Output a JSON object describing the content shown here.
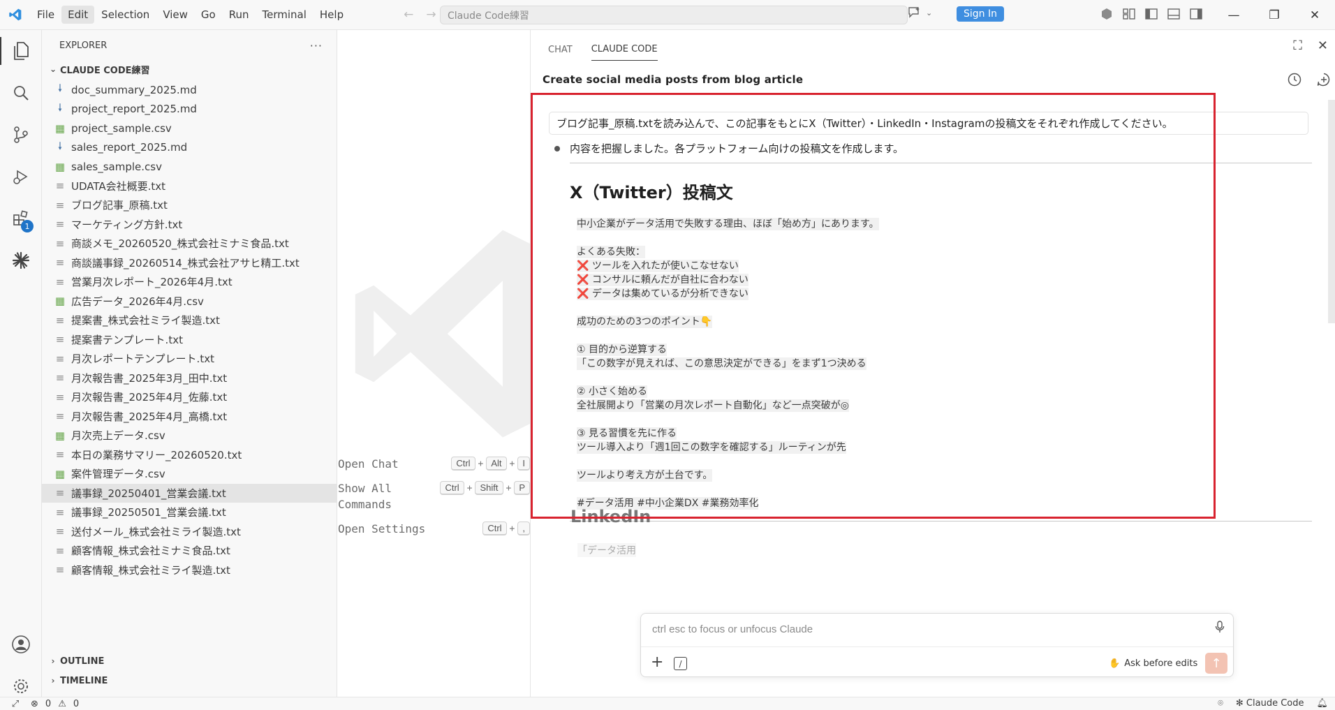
{
  "menu": {
    "items": [
      "File",
      "Edit",
      "Selection",
      "View",
      "Go",
      "Run",
      "Terminal",
      "Help"
    ],
    "active_index": 1
  },
  "command_center": {
    "text": "Claude Code練習"
  },
  "signin_label": "Sign In",
  "activity": {
    "extensions_badge": "1"
  },
  "explorer": {
    "title": "EXPLORER",
    "more": "···",
    "root": "CLAUDE CODE練習",
    "files": [
      {
        "name": "doc_summary_2025.md",
        "type": "md"
      },
      {
        "name": "project_report_2025.md",
        "type": "md"
      },
      {
        "name": "project_sample.csv",
        "type": "csv"
      },
      {
        "name": "sales_report_2025.md",
        "type": "md"
      },
      {
        "name": "sales_sample.csv",
        "type": "csv"
      },
      {
        "name": "UDATA会社概要.txt",
        "type": "txt"
      },
      {
        "name": "ブログ記事_原稿.txt",
        "type": "txt"
      },
      {
        "name": "マーケティング方針.txt",
        "type": "txt"
      },
      {
        "name": "商談メモ_20260520_株式会社ミナミ食品.txt",
        "type": "txt"
      },
      {
        "name": "商談議事録_20260514_株式会社アサヒ精工.txt",
        "type": "txt"
      },
      {
        "name": "営業月次レポート_2026年4月.txt",
        "type": "txt"
      },
      {
        "name": "広告データ_2026年4月.csv",
        "type": "csv"
      },
      {
        "name": "提案書_株式会社ミライ製造.txt",
        "type": "txt"
      },
      {
        "name": "提案書テンプレート.txt",
        "type": "txt"
      },
      {
        "name": "月次レポートテンプレート.txt",
        "type": "txt"
      },
      {
        "name": "月次報告書_2025年3月_田中.txt",
        "type": "txt"
      },
      {
        "name": "月次報告書_2025年4月_佐藤.txt",
        "type": "txt"
      },
      {
        "name": "月次報告書_2025年4月_高橋.txt",
        "type": "txt"
      },
      {
        "name": "月次売上データ.csv",
        "type": "csv"
      },
      {
        "name": "本日の業務サマリー_20260520.txt",
        "type": "txt"
      },
      {
        "name": "案件管理データ.csv",
        "type": "csv"
      },
      {
        "name": "議事録_20250401_営業会議.txt",
        "type": "txt",
        "selected": true
      },
      {
        "name": "議事録_20250501_営業会議.txt",
        "type": "txt"
      },
      {
        "name": "送付メール_株式会社ミライ製造.txt",
        "type": "txt"
      },
      {
        "name": "顧客情報_株式会社ミナミ食品.txt",
        "type": "txt"
      },
      {
        "name": "顧客情報_株式会社ミライ製造.txt",
        "type": "txt"
      }
    ],
    "outline": "OUTLINE",
    "timeline": "TIMELINE"
  },
  "editor": {
    "shortcuts": [
      {
        "label": "Open Chat",
        "keys": [
          "Ctrl",
          "Alt",
          "I"
        ]
      },
      {
        "label": "Show All Commands",
        "keys": [
          "Ctrl",
          "Shift",
          "P"
        ]
      },
      {
        "label": "Open Settings",
        "keys": [
          "Ctrl",
          ","
        ]
      }
    ]
  },
  "panel": {
    "tabs": [
      "CHAT",
      "CLAUDE CODE"
    ],
    "active_tab": 1,
    "session_title": "Create social media posts from blog article",
    "user_message": "ブログ記事_原稿.txtを読み込んで、この記事をもとにX（Twitter）・LinkedIn・Instagramの投稿文をそれぞれ作成してください。",
    "assistant_intro": "内容を把握しました。各プラットフォーム向けの投稿文を作成します。",
    "section1_title": "X（Twitter）投稿文",
    "post_lines": [
      "中小企業がデータ活用で失敗する理由、ほぼ「始め方」にあります。",
      "",
      "よくある失敗：",
      "❌ ツールを入れたが使いこなせない",
      "❌ コンサルに頼んだが自社に合わない",
      "❌ データは集めているが分析できない",
      "",
      "成功のための3つのポイント👇",
      "",
      "① 目的から逆算する",
      "「この数字が見えれば、この意思決定ができる」をまず1つ決める",
      "",
      "② 小さく始める",
      "全社展開より「営業の月次レポート自動化」など一点突破が◎",
      "",
      "③ 見る習慣を先に作る",
      "ツール導入より「週1回この数字を確認する」ルーティンが先",
      "",
      "ツールより考え方が土台です。",
      "",
      "#データ活用 #中小企業DX #業務効率化"
    ],
    "section2_title": "LinkedIn",
    "section2_preview": "「データ活用",
    "input_placeholder": "ctrl esc to focus or unfocus Claude",
    "ask_before_edits": "Ask before edits"
  },
  "status": {
    "errors": "0",
    "warnings": "0",
    "claude_label": "Claude Code"
  }
}
